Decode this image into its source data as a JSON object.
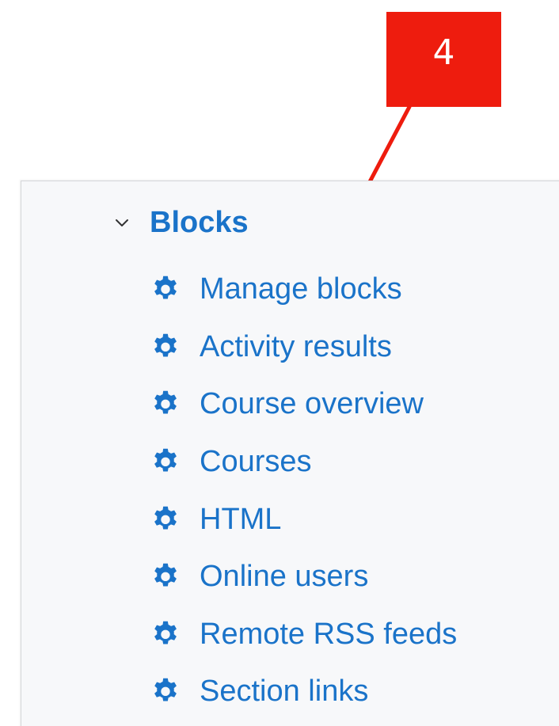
{
  "callout": {
    "number": "4",
    "color": "#ee1c0e"
  },
  "blocks": {
    "heading": "Blocks",
    "expanded": true,
    "link_color": "#1a73c9",
    "items": [
      {
        "label": "Manage blocks",
        "icon": "gear-icon"
      },
      {
        "label": "Activity results",
        "icon": "gear-icon"
      },
      {
        "label": "Course overview",
        "icon": "gear-icon"
      },
      {
        "label": "Courses",
        "icon": "gear-icon"
      },
      {
        "label": "HTML",
        "icon": "gear-icon"
      },
      {
        "label": "Online users",
        "icon": "gear-icon"
      },
      {
        "label": "Remote RSS feeds",
        "icon": "gear-icon"
      },
      {
        "label": "Section links",
        "icon": "gear-icon"
      }
    ]
  }
}
